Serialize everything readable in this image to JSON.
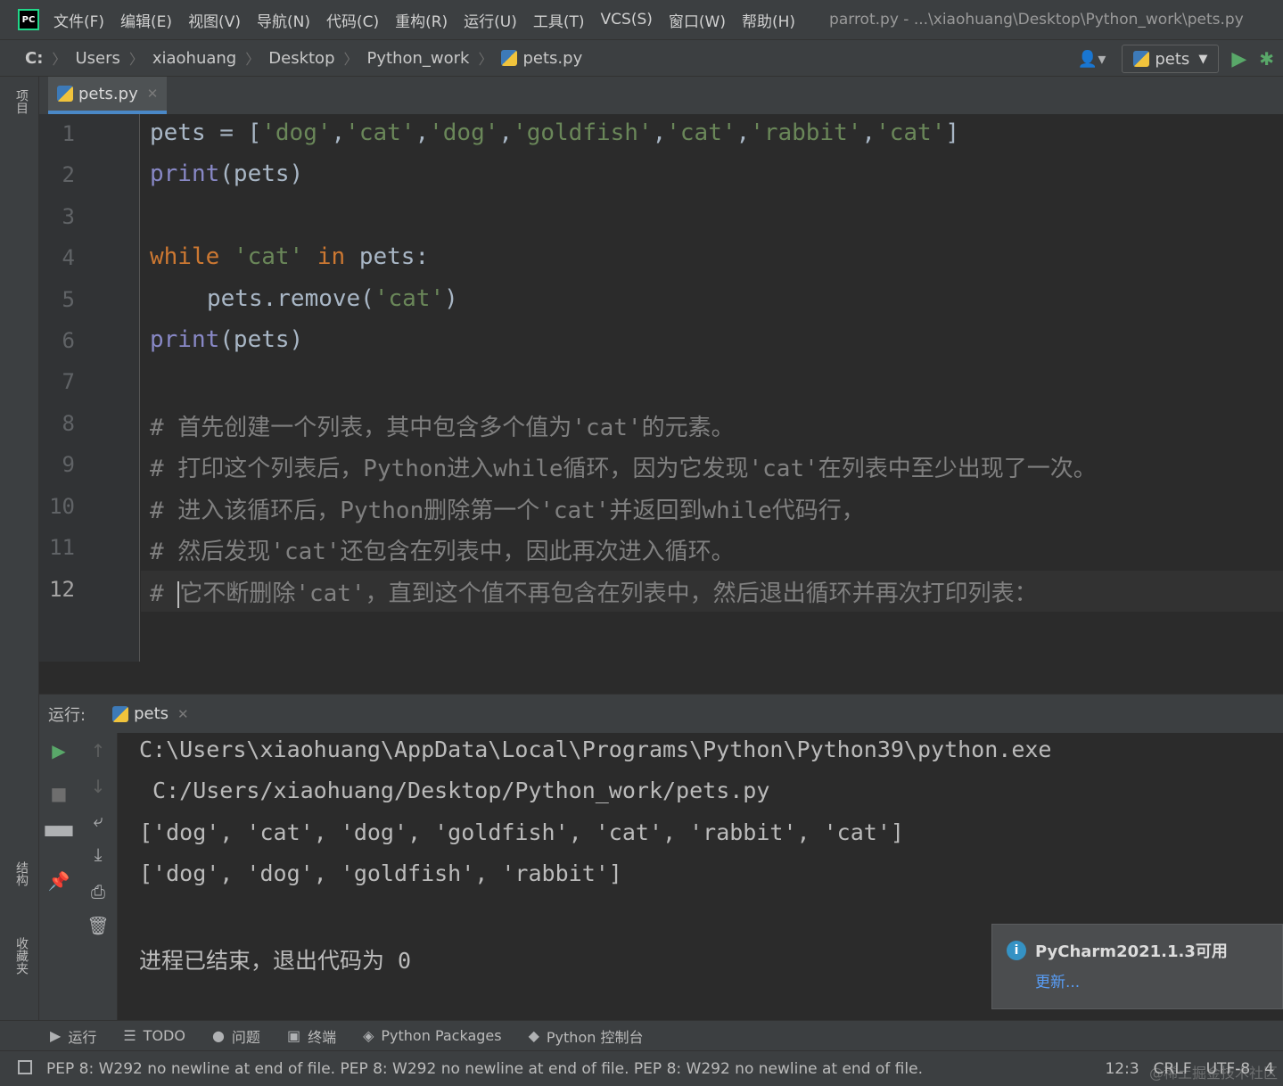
{
  "menubar": {
    "logo": "PC",
    "items": [
      "文件(F)",
      "编辑(E)",
      "视图(V)",
      "导航(N)",
      "代码(C)",
      "重构(R)",
      "运行(U)",
      "工具(T)",
      "VCS(S)",
      "窗口(W)",
      "帮助(H)"
    ],
    "window_title": "parrot.py - ...\\xiaohuang\\Desktop\\Python_work\\pets.py"
  },
  "navbar": {
    "crumbs": [
      "C:",
      "Users",
      "xiaohuang",
      "Desktop",
      "Python_work",
      "pets.py"
    ],
    "run_config": "pets"
  },
  "left_stripe": {
    "project": "项目",
    "structure": "结构",
    "favorites": "收藏夹"
  },
  "editor": {
    "tab": "pets.py",
    "line_numbers": [
      "1",
      "2",
      "3",
      "4",
      "5",
      "6",
      "7",
      "8",
      "9",
      "10",
      "11",
      "12"
    ],
    "current_line": "12",
    "lines": {
      "l1_a": "pets = [",
      "l1_s1": "'dog'",
      "l1_s2": "'cat'",
      "l1_s3": "'dog'",
      "l1_s4": "'goldfish'",
      "l1_s5": "'cat'",
      "l1_s6": "'rabbit'",
      "l1_s7": "'cat'",
      "comma": ",",
      "rbracket": "]",
      "print": "print",
      "pets_arg": "(pets)",
      "while": "while",
      "in": "in",
      "cat_str": "'cat'",
      "pets_colon": "pets:",
      "remove_call": "pets.remove(",
      "rparen": ")",
      "c8": "# 首先创建一个列表，其中包含多个值为'cat'的元素。",
      "c9": "# 打印这个列表后，Python进入while循环，因为它发现'cat'在列表中至少出现了一次。",
      "c10": "# 进入该循环后，Python删除第一个'cat'并返回到while代码行，",
      "c11": "# 然后发现'cat'还包含在列表中，因此再次进入循环。",
      "c12a": "# ",
      "c12b": "它不断删除'cat'，直到这个值不再包含在列表中，然后退出循环并再次打印列表："
    }
  },
  "run_panel": {
    "label": "运行:",
    "tab": "pets",
    "output": [
      "C:\\Users\\xiaohuang\\AppData\\Local\\Programs\\Python\\Python39\\python.exe",
      " C:/Users/xiaohuang/Desktop/Python_work/pets.py",
      "['dog', 'cat', 'dog', 'goldfish', 'cat', 'rabbit', 'cat']",
      "['dog', 'dog', 'goldfish', 'rabbit']",
      "",
      "进程已结束，退出代码为 0"
    ]
  },
  "notification": {
    "title": "PyCharm2021.1.3可用",
    "link": "更新..."
  },
  "bottom_tabs": [
    "运行",
    "TODO",
    "问题",
    "终端",
    "Python Packages",
    "Python 控制台"
  ],
  "status": {
    "message": "PEP 8: W292 no newline at end of file. PEP 8: W292 no newline at end of file. PEP 8: W292 no newline at end of file.",
    "position": "12:3",
    "line_sep": "CRLF",
    "encoding": "UTF-8",
    "indent": "4",
    "watermark": "@稀土掘金技术社区"
  },
  "colors": {
    "keyword": "#cc7832",
    "string": "#6a8759",
    "builtin": "#8888c6",
    "comment": "#808080",
    "accent": "#4a88c7",
    "run_green": "#59a869"
  }
}
